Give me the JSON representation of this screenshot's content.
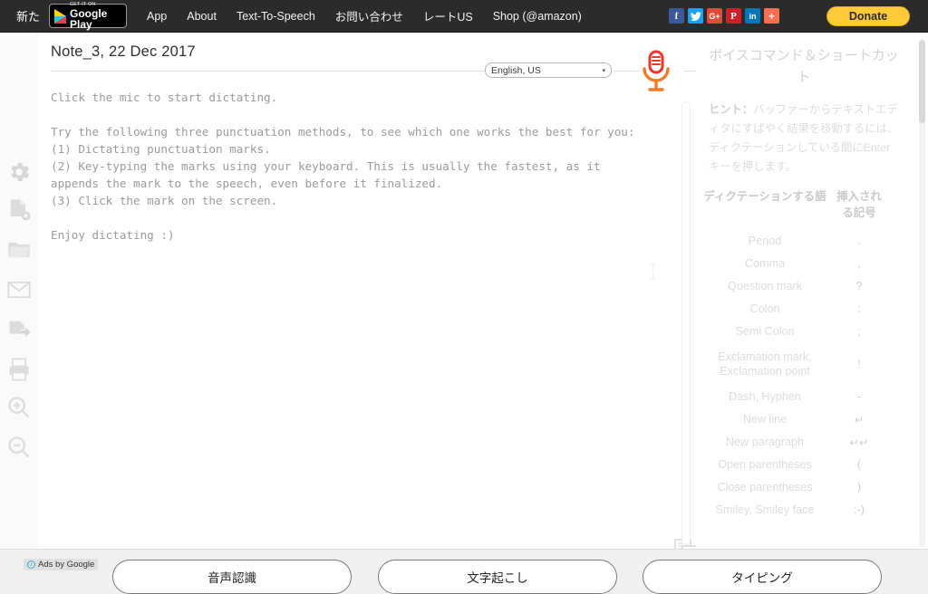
{
  "topnav": {
    "new_label": "新た",
    "gplay": {
      "line1": "GET IT ON",
      "line2": "Google Play"
    },
    "links": [
      {
        "label": "App"
      },
      {
        "label": "About"
      },
      {
        "label": "Text-To-Speech"
      },
      {
        "label": "お問い合わせ"
      },
      {
        "label": "レートUS"
      },
      {
        "label": "Shop (@amazon)"
      }
    ],
    "social": [
      {
        "name": "facebook-icon",
        "glyph": "f",
        "color": "#3b5998"
      },
      {
        "name": "twitter-icon",
        "glyph": "ᴡ",
        "color": "#1da1f2"
      },
      {
        "name": "google-plus-icon",
        "glyph": "G+",
        "color": "#dd4b39"
      },
      {
        "name": "pinterest-icon",
        "glyph": "P",
        "color": "#cb2027"
      },
      {
        "name": "linkedin-icon",
        "glyph": "in",
        "color": "#0077b5"
      },
      {
        "name": "share-more-icon",
        "glyph": "+",
        "color": "#fc6e51"
      }
    ],
    "donate_label": "Donate"
  },
  "rail": {
    "items": [
      {
        "name": "settings-icon",
        "label": "gear-icon"
      },
      {
        "name": "new-note-icon",
        "label": "new-document-icon"
      },
      {
        "name": "open-folder-icon",
        "label": "folder-icon"
      },
      {
        "name": "email-icon",
        "label": "envelope-icon"
      },
      {
        "name": "export-icon",
        "label": "export-icon"
      },
      {
        "name": "print-icon",
        "label": "printer-icon"
      },
      {
        "name": "zoom-in-icon",
        "label": "magnifier-plus-icon"
      },
      {
        "name": "zoom-out-icon",
        "label": "magnifier-minus-icon"
      }
    ]
  },
  "editor": {
    "title": "Note_3, 22 Dec 2017",
    "language": "English, US",
    "caret_glyph": "▾",
    "body": "Click the mic to start dictating.\n\nTry the following three punctuation methods, to see which one works the best for you:\n(1) Dictating punctuation marks.\n(2) Key-typing the marks using your keyboard. This is usually the fastest, as it\nappends the mark to the speech, even before it finalized.\n(3) Click the mark on the screen.\n\nEnjoy dictating :)"
  },
  "panel": {
    "title": "ボイスコマンド＆ショートカット",
    "hint_label": "ヒント：",
    "hint_text": "バッファーからテキストエディタにすばやく結果を移動するには、ディクテーションしている間にEnterキーを押します。",
    "table": {
      "header_word": "ディクテーションする語",
      "header_symbol": "挿入される記号",
      "rows": [
        {
          "word": "Period",
          "symbol": "."
        },
        {
          "word": "Comma",
          "symbol": ","
        },
        {
          "word": "Question mark",
          "symbol": "?"
        },
        {
          "word": "Colon",
          "symbol": ":"
        },
        {
          "word": "Semi Colon",
          "symbol": ";"
        },
        {
          "word": "Exclamation mark, Exclamation point",
          "symbol": "!"
        },
        {
          "word": "Dash, Hyphen",
          "symbol": "-"
        },
        {
          "word": "New line",
          "symbol": "↵"
        },
        {
          "word": "New paragraph",
          "symbol": "↵↵"
        },
        {
          "word": "Open parentheses",
          "symbol": "("
        },
        {
          "word": "Close parentheses",
          "symbol": ")"
        },
        {
          "word": "Smiley, Smiley face",
          "symbol": ":-)"
        }
      ]
    }
  },
  "bottom": {
    "ads_label": "Ads by Google",
    "ads_info_glyph": "i",
    "buttons": [
      {
        "label": "音声認識"
      },
      {
        "label": "文字起こし"
      },
      {
        "label": "タイピング"
      }
    ]
  },
  "colors": {
    "nav_bg": "#2b2b2b",
    "donate": "#ffc93c",
    "mic_red": "#f0342a",
    "mic_orange": "#f47a28",
    "panel_text": "#dcdcdc"
  }
}
